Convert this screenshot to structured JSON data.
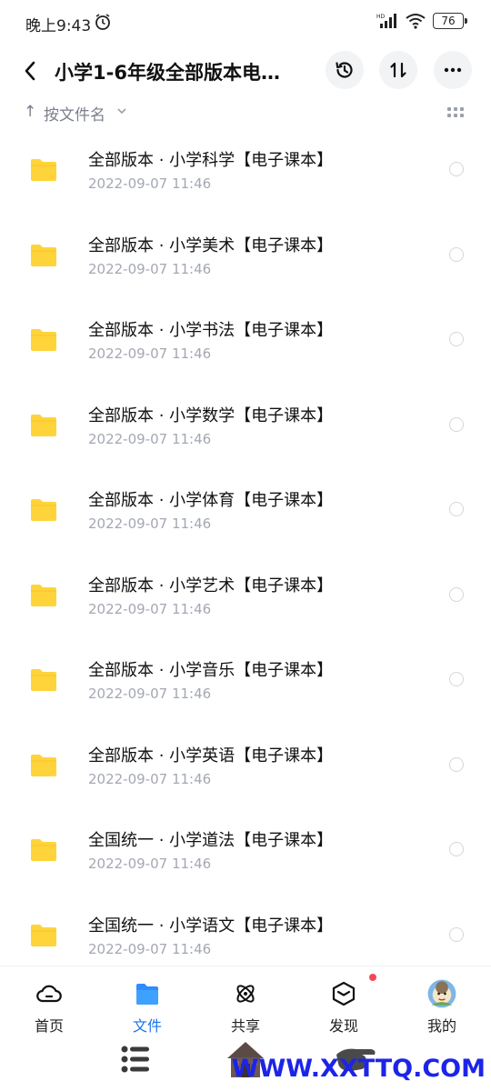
{
  "status_bar": {
    "time": "晚上9:43",
    "battery": "76"
  },
  "header": {
    "title": "小学1-6年级全部版本电…"
  },
  "sort": {
    "label": "按文件名"
  },
  "files": [
    {
      "name": "全部版本 · 小学科学【电子课本】",
      "date": "2022-09-07  11:46"
    },
    {
      "name": "全部版本 · 小学美术【电子课本】",
      "date": "2022-09-07  11:46"
    },
    {
      "name": "全部版本 · 小学书法【电子课本】",
      "date": "2022-09-07  11:46"
    },
    {
      "name": "全部版本 · 小学数学【电子课本】",
      "date": "2022-09-07  11:46"
    },
    {
      "name": "全部版本 · 小学体育【电子课本】",
      "date": "2022-09-07  11:46"
    },
    {
      "name": "全部版本 · 小学艺术【电子课本】",
      "date": "2022-09-07  11:46"
    },
    {
      "name": "全部版本 · 小学音乐【电子课本】",
      "date": "2022-09-07  11:46"
    },
    {
      "name": "全部版本 · 小学英语【电子课本】",
      "date": "2022-09-07  11:46"
    },
    {
      "name": "全国统一 · 小学道法【电子课本】",
      "date": "2022-09-07  11:46"
    },
    {
      "name": "全国统一 · 小学语文【电子课本】",
      "date": "2022-09-07  11:46"
    }
  ],
  "nav": {
    "home": "首页",
    "files": "文件",
    "share": "共享",
    "discover": "发现",
    "me": "我的"
  },
  "watermark": "WWW.XXTTQ.COM",
  "colors": {
    "accent": "#1a73e8",
    "folder": "#ffd43b",
    "badge": "#f4465c",
    "watermark": "#1d24e8"
  }
}
